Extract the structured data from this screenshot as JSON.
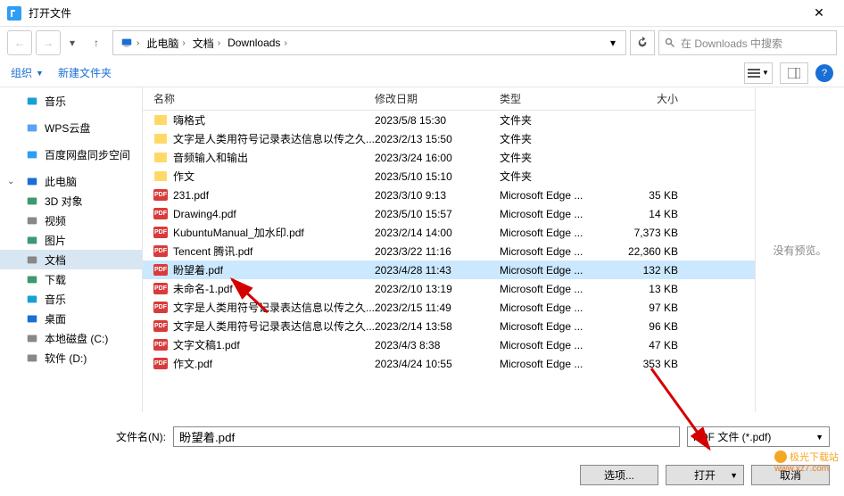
{
  "titlebar": {
    "title": "打开文件"
  },
  "nav": {
    "path": [
      "此电脑",
      "文档",
      "Downloads"
    ],
    "searchPlaceholder": "在 Downloads 中搜索"
  },
  "toolbar": {
    "organize": "组织",
    "newFolder": "新建文件夹"
  },
  "sidebar": {
    "items": [
      {
        "label": "音乐",
        "icon": "music",
        "color": "#1a9fd4"
      },
      {
        "label": "WPS云盘",
        "icon": "cloud",
        "color": "#5aa3f0"
      },
      {
        "label": "百度网盘同步空间",
        "icon": "sync",
        "color": "#2e9df4"
      },
      {
        "label": "此电脑",
        "icon": "pc",
        "color": "#1a6fd4",
        "expanded": true
      },
      {
        "label": "3D 对象",
        "icon": "3d",
        "color": "#3d9970"
      },
      {
        "label": "视频",
        "icon": "video",
        "color": "#888"
      },
      {
        "label": "图片",
        "icon": "image",
        "color": "#3d9970"
      },
      {
        "label": "文档",
        "icon": "doc",
        "color": "#888",
        "active": true
      },
      {
        "label": "下载",
        "icon": "download",
        "color": "#3d9970"
      },
      {
        "label": "音乐",
        "icon": "music2",
        "color": "#1a9fd4"
      },
      {
        "label": "桌面",
        "icon": "desktop",
        "color": "#1a6fd4"
      },
      {
        "label": "本地磁盘 (C:)",
        "icon": "disk",
        "color": "#888"
      },
      {
        "label": "软件 (D:)",
        "icon": "disk",
        "color": "#888"
      }
    ]
  },
  "columns": {
    "name": "名称",
    "date": "修改日期",
    "type": "类型",
    "size": "大小"
  },
  "files": [
    {
      "name": "嗨格式",
      "date": "2023/5/8 15:30",
      "type": "文件夹",
      "size": "",
      "kind": "folder"
    },
    {
      "name": "文字是人类用符号记录表达信息以传之久...",
      "date": "2023/2/13 15:50",
      "type": "文件夹",
      "size": "",
      "kind": "folder"
    },
    {
      "name": "音频输入和输出",
      "date": "2023/3/24 16:00",
      "type": "文件夹",
      "size": "",
      "kind": "folder"
    },
    {
      "name": "作文",
      "date": "2023/5/10 15:10",
      "type": "文件夹",
      "size": "",
      "kind": "folder"
    },
    {
      "name": "231.pdf",
      "date": "2023/3/10 9:13",
      "type": "Microsoft Edge ...",
      "size": "35 KB",
      "kind": "pdf"
    },
    {
      "name": "Drawing4.pdf",
      "date": "2023/5/10 15:57",
      "type": "Microsoft Edge ...",
      "size": "14 KB",
      "kind": "pdf"
    },
    {
      "name": "KubuntuManual_加水印.pdf",
      "date": "2023/2/14 14:00",
      "type": "Microsoft Edge ...",
      "size": "7,373 KB",
      "kind": "pdf"
    },
    {
      "name": "Tencent 腾讯.pdf",
      "date": "2023/3/22 11:16",
      "type": "Microsoft Edge ...",
      "size": "22,360 KB",
      "kind": "pdf"
    },
    {
      "name": "盼望着.pdf",
      "date": "2023/4/28 11:43",
      "type": "Microsoft Edge ...",
      "size": "132 KB",
      "kind": "pdf",
      "selected": true
    },
    {
      "name": "未命名-1.pdf",
      "date": "2023/2/10 13:19",
      "type": "Microsoft Edge ...",
      "size": "13 KB",
      "kind": "pdf"
    },
    {
      "name": "文字是人类用符号记录表达信息以传之久...",
      "date": "2023/2/15 11:49",
      "type": "Microsoft Edge ...",
      "size": "97 KB",
      "kind": "pdf"
    },
    {
      "name": "文字是人类用符号记录表达信息以传之久...",
      "date": "2023/2/14 13:58",
      "type": "Microsoft Edge ...",
      "size": "96 KB",
      "kind": "pdf"
    },
    {
      "name": "文字文稿1.pdf",
      "date": "2023/4/3 8:38",
      "type": "Microsoft Edge ...",
      "size": "47 KB",
      "kind": "pdf"
    },
    {
      "name": "作文.pdf",
      "date": "2023/4/24 10:55",
      "type": "Microsoft Edge ...",
      "size": "353 KB",
      "kind": "pdf"
    }
  ],
  "preview": {
    "noPreview": "没有预览。"
  },
  "bottom": {
    "filenameLabel": "文件名(N):",
    "filenameValue": "盼望着.pdf",
    "filetypeLabel": "PDF 文件 (*.pdf)",
    "options": "选项...",
    "open": "打开",
    "cancel": "取消"
  },
  "watermark": {
    "line1": "极光下载站",
    "line2": "www.xz7.com"
  }
}
